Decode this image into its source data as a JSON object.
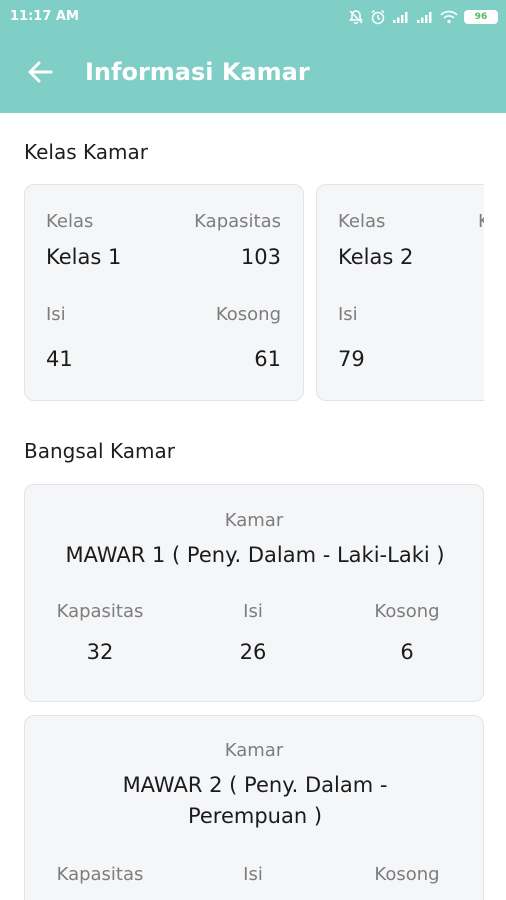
{
  "status_bar": {
    "time": "11:17 AM",
    "battery": "96"
  },
  "header": {
    "title": "Informasi Kamar"
  },
  "sections": {
    "kelas_title": "Kelas Kamar",
    "bangsal_title": "Bangsal Kamar"
  },
  "labels": {
    "kelas": "Kelas",
    "kapasitas": "Kapasitas",
    "isi": "Isi",
    "kosong": "Kosong",
    "kamar": "Kamar"
  },
  "kelas_cards": [
    {
      "kelas": "Kelas 1",
      "kapasitas": "103",
      "isi": "41",
      "kosong": "61"
    },
    {
      "kelas": "Kelas 2",
      "isi": "79"
    }
  ],
  "bangsal_cards": [
    {
      "name": "MAWAR 1 ( Peny. Dalam - Laki-Laki )",
      "kapasitas": "32",
      "isi": "26",
      "kosong": "6"
    },
    {
      "name_line1": "MAWAR 2 ( Peny. Dalam -",
      "name_line2": "Perempuan )"
    }
  ],
  "icons": [
    "bell-off-icon",
    "alarm-icon",
    "signal-icon",
    "signal-icon-2",
    "wifi-icon",
    "battery-icon",
    "back-arrow-icon"
  ],
  "colors": {
    "header": "#7fcfc6",
    "card_bg": "#f5f6f8",
    "battery_fill": "#4bbf5c"
  }
}
